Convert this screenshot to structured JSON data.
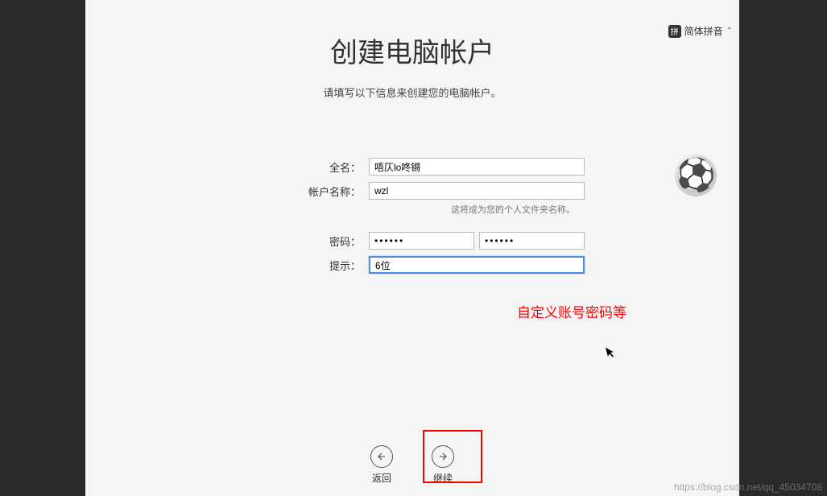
{
  "ime": {
    "badge": "拼",
    "label": "简体拼音"
  },
  "header": {
    "title": "创建电脑帐户",
    "subtitle": "请填写以下信息来创建您的电脑帐户。"
  },
  "form": {
    "fullname_label": "全名：",
    "fullname_value": "唔仄lo咚锵",
    "account_label": "帐户名称：",
    "account_value": "wzl",
    "account_hint": "这将成为您的个人文件夹名称。",
    "password_label": "密码：",
    "password_value": "••••••",
    "password_confirm_value": "••••••",
    "hint_label": "提示：",
    "hint_value": "6位",
    "avatar_icon": "soccer-ball"
  },
  "annotation": {
    "text": "自定义账号密码等"
  },
  "nav": {
    "back_label": "返回",
    "continue_label": "继续"
  },
  "watermark": "https://blog.csdn.net/qq_45034708"
}
